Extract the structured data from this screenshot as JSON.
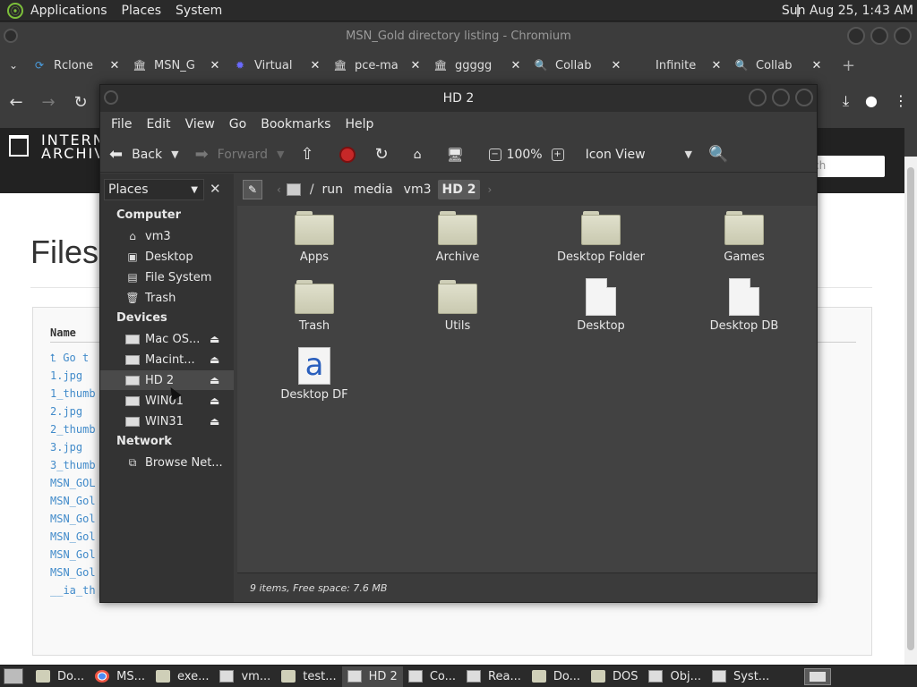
{
  "top_panel": {
    "menus": [
      "Applications",
      "Places",
      "System"
    ],
    "clock": "Sun Aug 25, 1:43 AM"
  },
  "chromium": {
    "title": "MSN_Gold directory listing - Chromium",
    "tabs": [
      {
        "label": "Rclone",
        "icon": "rclone-icon"
      },
      {
        "label": "MSN_G",
        "icon": "archive-icon"
      },
      {
        "label": "Virtual",
        "icon": "virtual-icon"
      },
      {
        "label": "pce-ma",
        "icon": "archive-icon"
      },
      {
        "label": "ggggg",
        "icon": "archive-icon"
      },
      {
        "label": "Collab",
        "icon": "search-icon"
      },
      {
        "label": "Infinite",
        "icon": "infinite-icon"
      },
      {
        "label": "Collab",
        "icon": "search-icon"
      }
    ]
  },
  "webpage": {
    "logo_line1": "INTERNET",
    "logo_line2": "ARCHIVE",
    "search_placeholder": "ch",
    "heading": "Files",
    "col_name": "Name",
    "files": [
      "⮤ Go t",
      "1.jpg",
      "1_thumb",
      "2.jpg",
      "2_thumb",
      "3.jpg",
      "3_thumb",
      "MSN_GOL",
      "MSN_Gol",
      "MSN_Gol",
      "MSN_Gol",
      "MSN_Gol",
      "MSN_Gol",
      "__ia_th"
    ]
  },
  "file_manager": {
    "title": "HD 2",
    "menus": [
      "File",
      "Edit",
      "View",
      "Go",
      "Bookmarks",
      "Help"
    ],
    "toolbar": {
      "back": "Back",
      "forward": "Forward",
      "zoom": "100%",
      "view_mode": "Icon View"
    },
    "sidebar": {
      "selector": "Places",
      "computer_heading": "Computer",
      "computer_items": [
        "vm3",
        "Desktop",
        "File System",
        "Trash"
      ],
      "devices_heading": "Devices",
      "device_items": [
        "Mac OS...",
        "Macint...",
        "HD 2",
        "WIN01",
        "WIN31"
      ],
      "network_heading": "Network",
      "network_items": [
        "Browse Net..."
      ]
    },
    "path": [
      "run",
      "media",
      "vm3",
      "HD 2"
    ],
    "items": [
      {
        "name": "Apps",
        "type": "folder"
      },
      {
        "name": "Archive",
        "type": "folder"
      },
      {
        "name": "Desktop Folder",
        "type": "folder"
      },
      {
        "name": "Games",
        "type": "folder"
      },
      {
        "name": "Trash",
        "type": "folder"
      },
      {
        "name": "Utils",
        "type": "folder"
      },
      {
        "name": "Desktop",
        "type": "document"
      },
      {
        "name": "Desktop DB",
        "type": "document"
      },
      {
        "name": "Desktop DF",
        "type": "application"
      }
    ],
    "status": "9 items, Free space: 7.6 MB"
  },
  "taskbar": {
    "items": [
      {
        "label": "Do...",
        "icon": "folder"
      },
      {
        "label": "MS...",
        "icon": "chrome"
      },
      {
        "label": "exe...",
        "icon": "folder"
      },
      {
        "label": "vm...",
        "icon": "win"
      },
      {
        "label": "test...",
        "icon": "folder"
      },
      {
        "label": "HD 2",
        "icon": "win"
      },
      {
        "label": "Co...",
        "icon": "win"
      },
      {
        "label": "Rea...",
        "icon": "win"
      },
      {
        "label": "Do...",
        "icon": "folder"
      },
      {
        "label": "DOS",
        "icon": "folder"
      },
      {
        "label": "Obj...",
        "icon": "win"
      },
      {
        "label": "Syst...",
        "icon": "win"
      }
    ]
  }
}
